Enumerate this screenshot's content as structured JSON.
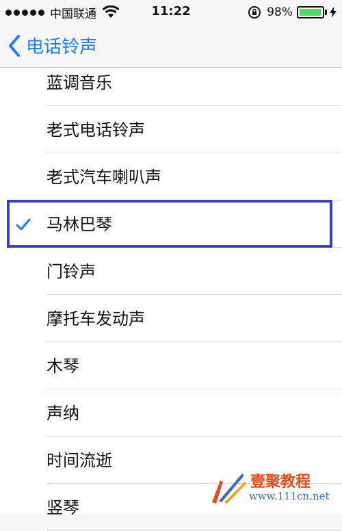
{
  "status_bar": {
    "carrier": "中国联通",
    "time": "11:22",
    "battery_percent": "98%",
    "battery_level": 0.98,
    "icons": [
      "signal-dots-icon",
      "wifi-icon",
      "orientation-lock-icon",
      "battery-icon",
      "charging-bolt-icon"
    ]
  },
  "nav": {
    "back_label": "电话铃声",
    "back_icon": "chevron-left-icon"
  },
  "ringtones": [
    {
      "label": "蓝调音乐",
      "selected": false
    },
    {
      "label": "老式电话铃声",
      "selected": false
    },
    {
      "label": "老式汽车喇叭声",
      "selected": false
    },
    {
      "label": "马林巴琴",
      "selected": true
    },
    {
      "label": "门铃声",
      "selected": false
    },
    {
      "label": "摩托车发动声",
      "selected": false
    },
    {
      "label": "木琴",
      "selected": false
    },
    {
      "label": "声纳",
      "selected": false
    },
    {
      "label": "时间流逝",
      "selected": false
    },
    {
      "label": "竖琴",
      "selected": false
    }
  ],
  "watermark": {
    "brand": "壹聚教程",
    "url": "www.111cn.net"
  },
  "colors": {
    "accent": "#1a7cf5",
    "highlight_border": "#3a3fc4",
    "battery_fill": "#4cd964"
  }
}
